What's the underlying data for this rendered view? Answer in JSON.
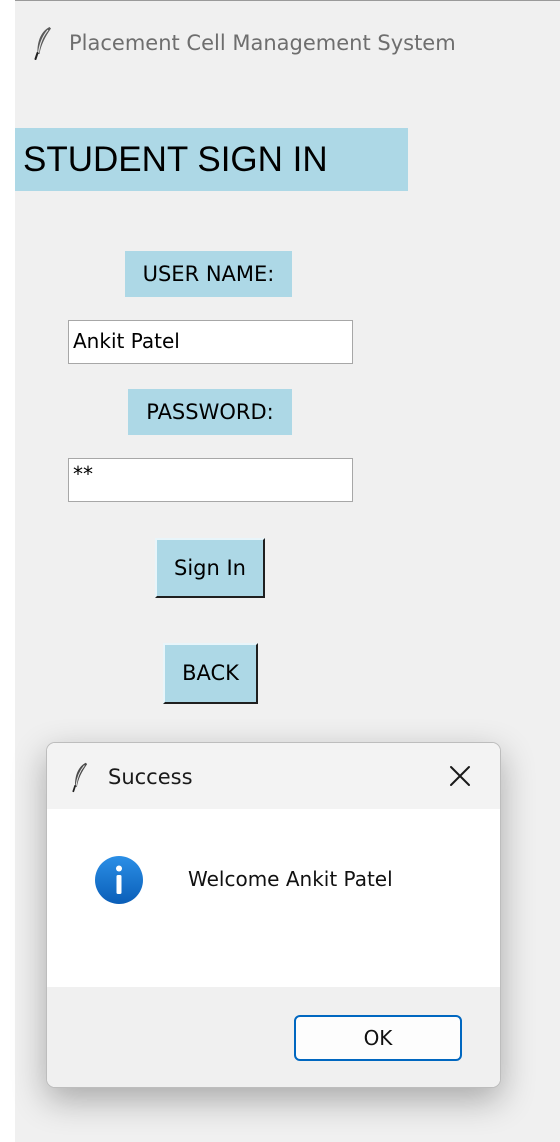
{
  "window": {
    "title": "Placement Cell Management System",
    "icon": "feather-icon"
  },
  "form": {
    "heading": "STUDENT SIGN IN",
    "username_label": "USER NAME:",
    "username_value": "Ankit Patel",
    "password_label": "PASSWORD:",
    "password_value": "**",
    "signin_label": "Sign In",
    "back_label": "BACK"
  },
  "dialog": {
    "title": "Success",
    "icon": "info-icon",
    "message": "Welcome Ankit Patel",
    "ok_label": "OK"
  },
  "colors": {
    "label_bg": "#add8e6",
    "window_bg": "#f0f0f0",
    "ok_border": "#0067c0",
    "info_icon": "#0f6cbd"
  }
}
